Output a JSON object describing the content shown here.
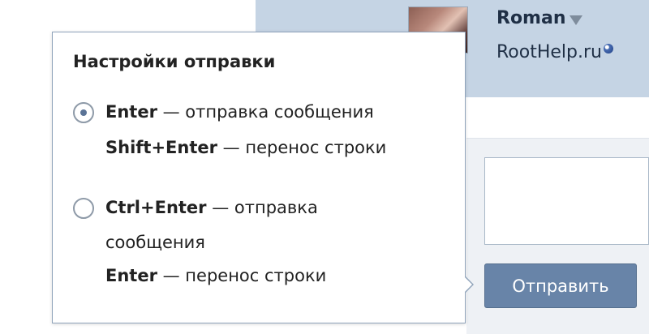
{
  "header": {
    "user_name": "Roman",
    "site_link": "RootHelp.ru"
  },
  "composer": {
    "send_label": "Отправить"
  },
  "popup": {
    "title": "Настройки отправки",
    "option1": {
      "line1_key": "Enter",
      "line1_text": " — отправка сообщения",
      "line2_key": "Shift+Enter",
      "line2_text": " — перенос строки",
      "selected": true
    },
    "option2": {
      "line1_key": "Ctrl+Enter",
      "line1_text": " — отправка",
      "line2_text": "сообщения",
      "line3_key": "Enter",
      "line3_text": " — перенос строки",
      "selected": false
    }
  },
  "icons": {
    "caret": "chevron-down-icon",
    "globe": "globe-icon",
    "radio_checked": "radio-checked-icon",
    "radio_unchecked": "radio-unchecked-icon"
  },
  "colors": {
    "header_bg": "#c5d4e4",
    "button_bg": "#6884a8",
    "popup_border": "#8fa3ba"
  }
}
